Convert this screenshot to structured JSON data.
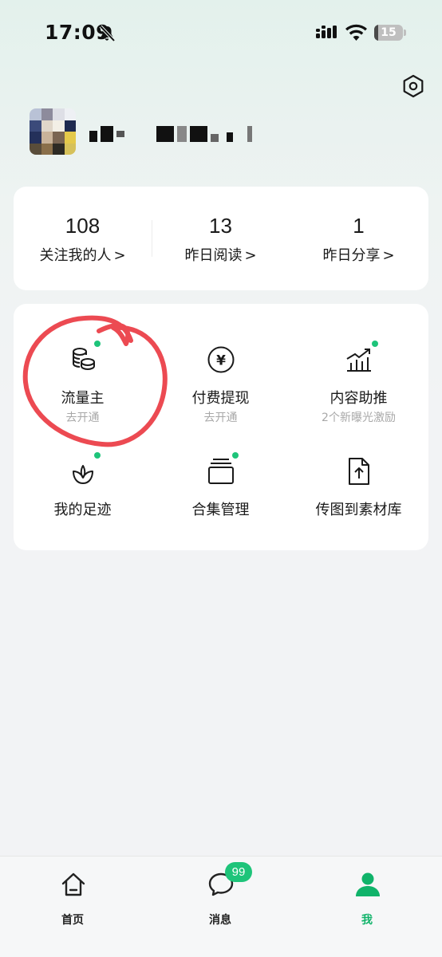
{
  "status_bar": {
    "time": "17:09",
    "battery_level": "15"
  },
  "profile": {
    "avatar_icon": "pixelated-avatar",
    "username_icon": "pixelated-username"
  },
  "stats": [
    {
      "value": "108",
      "label": "关注我的人"
    },
    {
      "value": "13",
      "label": "昨日阅读"
    },
    {
      "value": "1",
      "label": "昨日分享"
    }
  ],
  "stat_chevron": ">",
  "tools": [
    {
      "name": "流量主",
      "sub": "去开通",
      "icon": "coins-icon",
      "has_dot": true
    },
    {
      "name": "付费提现",
      "sub": "去开通",
      "icon": "yen-circle-icon",
      "has_dot": false
    },
    {
      "name": "内容助推",
      "sub": "2个新曝光激励",
      "icon": "growth-chart-icon",
      "has_dot": true
    },
    {
      "name": "我的足迹",
      "sub": "",
      "icon": "sprout-icon",
      "has_dot": true
    },
    {
      "name": "合集管理",
      "sub": "",
      "icon": "collection-icon",
      "has_dot": true
    },
    {
      "name": "传图到素材库",
      "sub": "",
      "icon": "upload-file-icon",
      "has_dot": false
    }
  ],
  "tab_bar": {
    "tabs": [
      {
        "label": "首页",
        "icon": "home-icon"
      },
      {
        "label": "消息",
        "icon": "chat-bubble-icon"
      },
      {
        "label": "我",
        "icon": "person-icon"
      }
    ],
    "message_badge": "99",
    "active_tab": "我"
  },
  "colors": {
    "accent": "#1ec47a",
    "active_tab": "#10b36a",
    "annotation_red": "#ec4a52"
  }
}
